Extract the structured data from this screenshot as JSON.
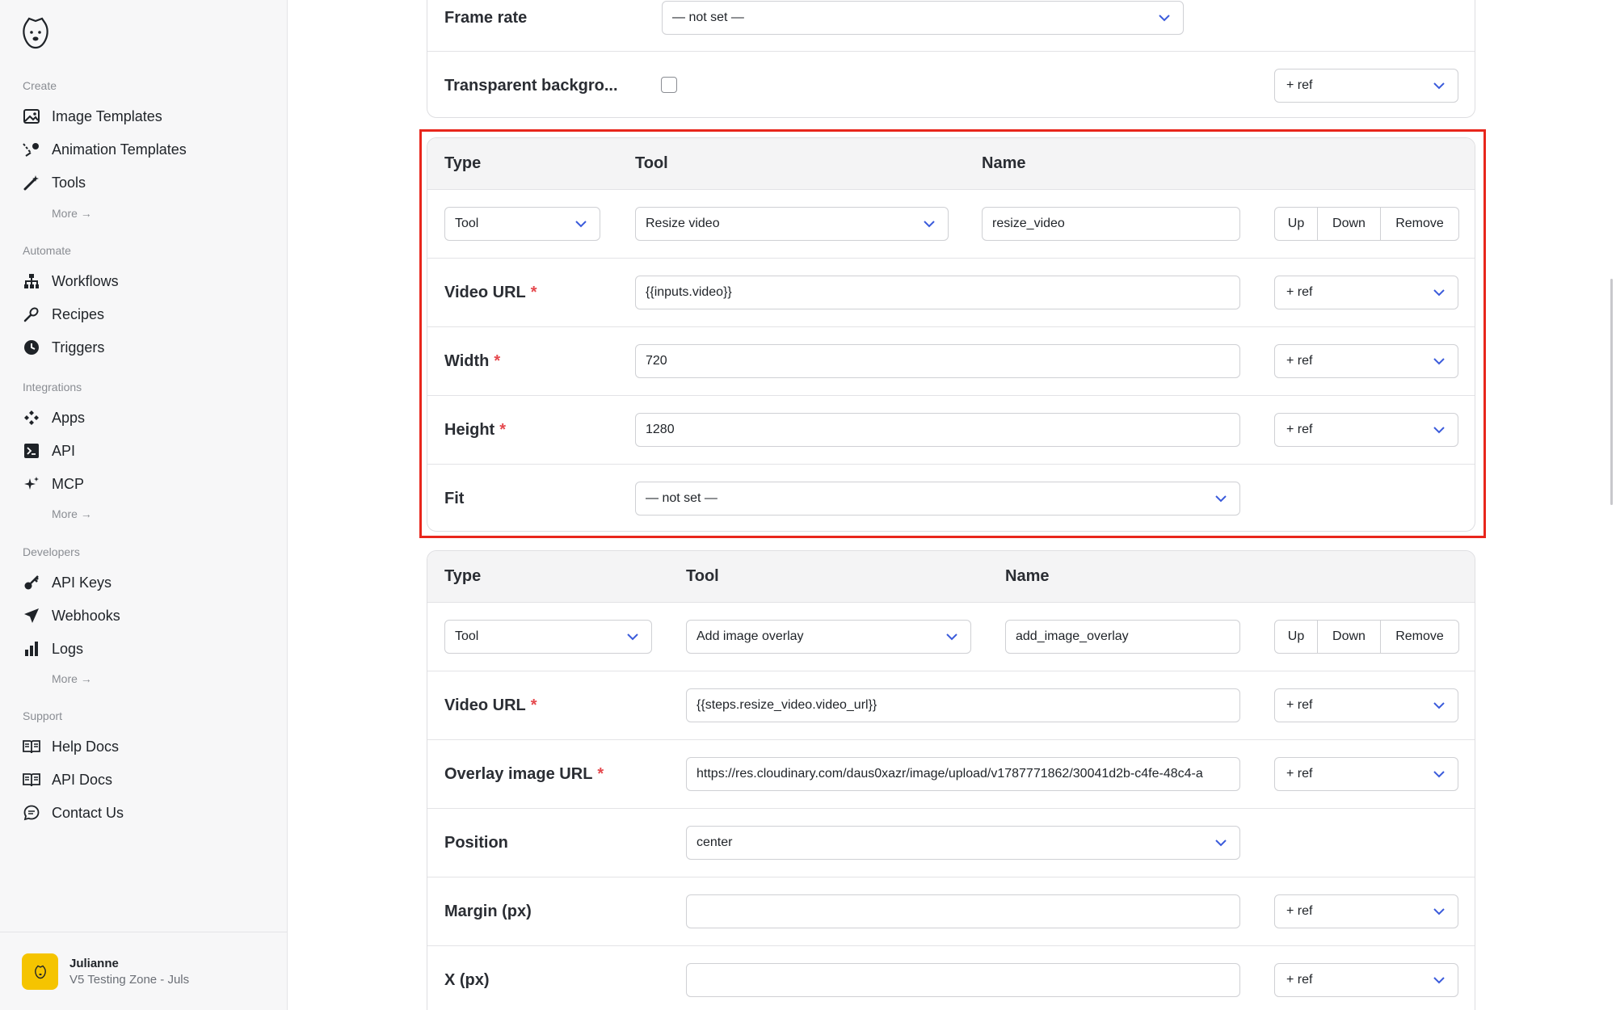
{
  "sidebar": {
    "sections": {
      "create": "Create",
      "automate": "Automate",
      "integrations": "Integrations",
      "developers": "Developers",
      "support": "Support"
    },
    "items": {
      "image_templates": "Image Templates",
      "animation_templates": "Animation Templates",
      "tools": "Tools",
      "workflows": "Workflows",
      "recipes": "Recipes",
      "triggers": "Triggers",
      "apps": "Apps",
      "api": "API",
      "mcp": "MCP",
      "api_keys": "API Keys",
      "webhooks": "Webhooks",
      "logs": "Logs",
      "help_docs": "Help Docs",
      "api_docs": "API Docs",
      "contact_us": "Contact Us"
    },
    "more": "More →",
    "user": {
      "name": "Julianne",
      "zone": "V5 Testing Zone - Juls"
    }
  },
  "top_card": {
    "frame_rate_label": "Frame rate",
    "frame_rate_value": "— not set —",
    "transparent_label": "Transparent backgro...",
    "transparent_checked": false,
    "ref_label": "+ ref"
  },
  "headers": {
    "type": "Type",
    "tool": "Tool",
    "name": "Name"
  },
  "actions": {
    "up": "Up",
    "down": "Down",
    "remove": "Remove"
  },
  "step1": {
    "type": "Tool",
    "tool": "Resize video",
    "name": "resize_video",
    "fields": {
      "video_url": {
        "label": "Video URL",
        "value": "{{inputs.video}}"
      },
      "width": {
        "label": "Width",
        "value": "720"
      },
      "height": {
        "label": "Height",
        "value": "1280"
      },
      "fit": {
        "label": "Fit",
        "value": "— not set —"
      }
    }
  },
  "step2": {
    "type": "Tool",
    "tool": "Add image overlay",
    "name": "add_image_overlay",
    "fields": {
      "video_url": {
        "label": "Video URL",
        "value": "{{steps.resize_video.video_url}}"
      },
      "overlay": {
        "label": "Overlay image URL",
        "value": "https://res.cloudinary.com/daus0xazr/image/upload/v1787771862/30041d2b-c4fe-48c4-a"
      },
      "position": {
        "label": "Position",
        "value": "center"
      },
      "margin": {
        "label": "Margin (px)",
        "value": ""
      },
      "x": {
        "label": "X (px)",
        "value": ""
      }
    }
  },
  "required_mark": "*",
  "colors": {
    "accent": "#3b5bdb",
    "highlight": "#e8261c",
    "required": "#e5484d",
    "avatar": "#f5c400"
  }
}
